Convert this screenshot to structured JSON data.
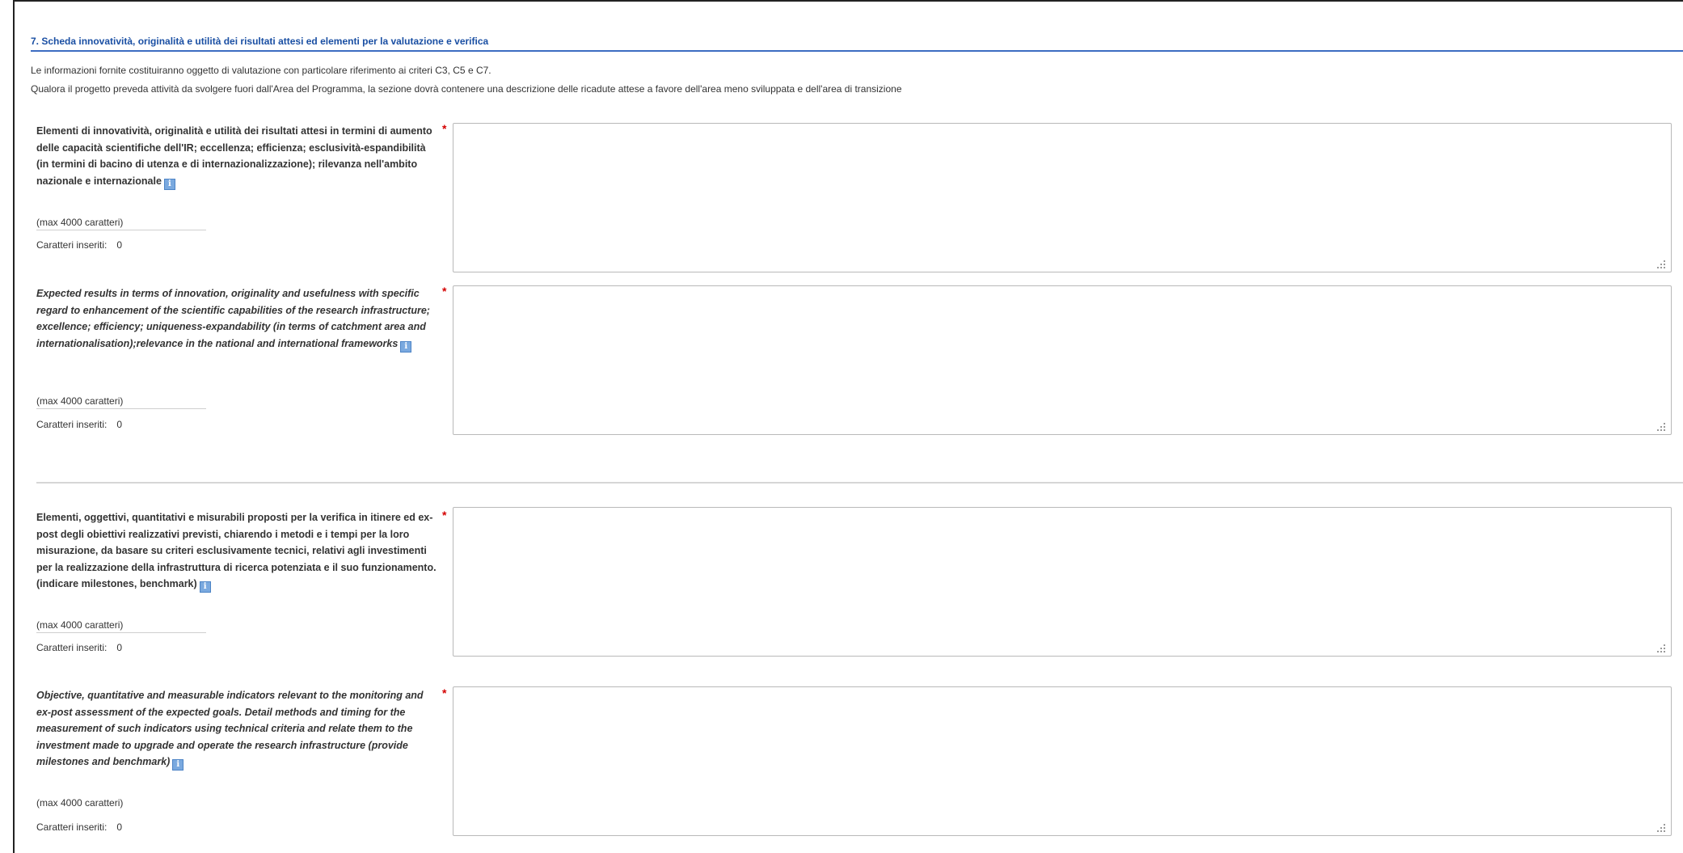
{
  "section": {
    "title": "7. Scheda innovatività, originalità e utilità dei risultati attesi ed elementi per la valutazione e verifica",
    "intro_line1": "Le informazioni fornite costituiranno oggetto di valutazione con particolare riferimento ai criteri C3, C5 e C7.",
    "intro_line2": "Qualora il progetto preveda attività da svolgere fuori dall'Area del Programma, la sezione dovrà contenere una descrizione delle ricadute attese a favore dell'area meno sviluppata e dell'area di transizione"
  },
  "fields": [
    {
      "label": "Elementi di innovatività, originalità e utilità dei risultati attesi in termini di aumento delle capacità scientifiche dell'IR; eccellenza; efficienza; esclusività-espandibilità (in termini di bacino di utenza e di internazionalizzazione); rilevanza nell'ambito nazionale e internazionale",
      "max_note": "(max 4000 caratteri)",
      "counter_label": "Caratteri inseriti:",
      "counter_value": "0",
      "required_mark": "*",
      "value": ""
    },
    {
      "label": "Expected results in terms of innovation, originality and usefulness with specific regard to enhancement of the scientific capabilities of the research infrastructure; excellence; efficiency; uniqueness-expandability (in terms of catchment area and internationalisation);relevance in the national and international frameworks",
      "max_note": "(max 4000 caratteri)",
      "counter_label": "Caratteri inseriti:",
      "counter_value": "0",
      "required_mark": "*",
      "value": ""
    },
    {
      "label": "Elementi, oggettivi, quantitativi e misurabili proposti per la verifica in itinere ed ex-post degli obiettivi realizzativi previsti, chiarendo i metodi e i tempi per la loro misurazione, da basare su criteri esclusivamente tecnici, relativi agli investimenti per la realizzazione della infrastruttura di ricerca potenziata e il suo funzionamento. (indicare milestones, benchmark)",
      "max_note": "(max 4000 caratteri)",
      "counter_label": "Caratteri inseriti:",
      "counter_value": "0",
      "required_mark": "*",
      "value": ""
    },
    {
      "label": "Objective, quantitative and measurable indicators relevant to the monitoring and ex-post assessment of the expected goals. Detail methods and timing for the measurement of such indicators using technical criteria and relate them to the investment made to upgrade and operate the research infrastructure (provide milestones and benchmark)",
      "max_note": "(max 4000 caratteri)",
      "counter_label": "Caratteri inseriti:",
      "counter_value": "0",
      "required_mark": "*",
      "value": ""
    }
  ],
  "icons": {
    "info": "info-icon",
    "info_glyph": "i",
    "resize": "resize-grip-icon"
  },
  "colors": {
    "title": "#1a4fa3",
    "title_rule": "#3c6cc2",
    "required": "#d40000",
    "info_icon": "#7aa9df"
  }
}
